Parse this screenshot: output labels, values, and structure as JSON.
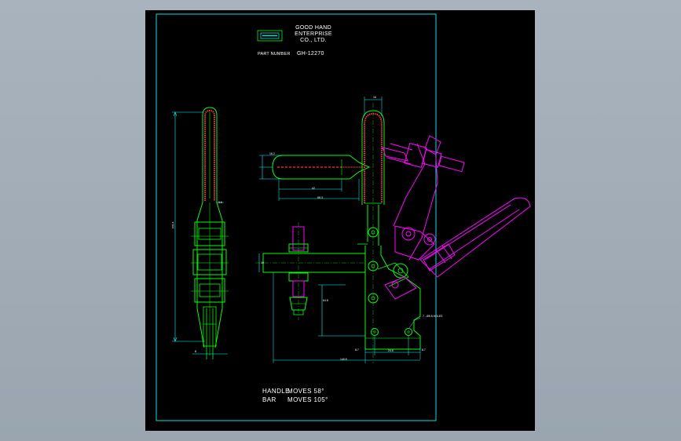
{
  "title_block": {
    "company_line1": "GOOD HAND",
    "company_line2": "ENTERPRISE",
    "company_line3": "CO., LTD.",
    "part_number_label": "PART NUMBER",
    "part_number": "GH-12270"
  },
  "notes": {
    "handle_label": "HANDLE",
    "handle_moves": "MOVES 58°",
    "bar_label": "BAR",
    "bar_moves": "MOVES 105°"
  },
  "dimensions": {
    "d_top": "16",
    "d_left_height": "203.4",
    "d_left_small": "5.6",
    "d_left_bottom": "8",
    "d_bolt_dia": "16.2",
    "d_bolt_len": "42",
    "d_bolt_total": "68.3",
    "d_bar_width": "10",
    "d_base_height": "64.8",
    "d_base_a": "8.7",
    "d_base_b": "24.6",
    "d_base_c": "8.7",
    "d_base_total": "140.5",
    "d_holes": "7 - Ø8.5 HOLES"
  },
  "colors": {
    "frame": "#00e0e0",
    "outline": "#00ff00",
    "hatch": "#ff3030",
    "ghost": "#ff00ff",
    "dim": "#00ffff",
    "text": "#ffffff",
    "background": "#000000"
  }
}
